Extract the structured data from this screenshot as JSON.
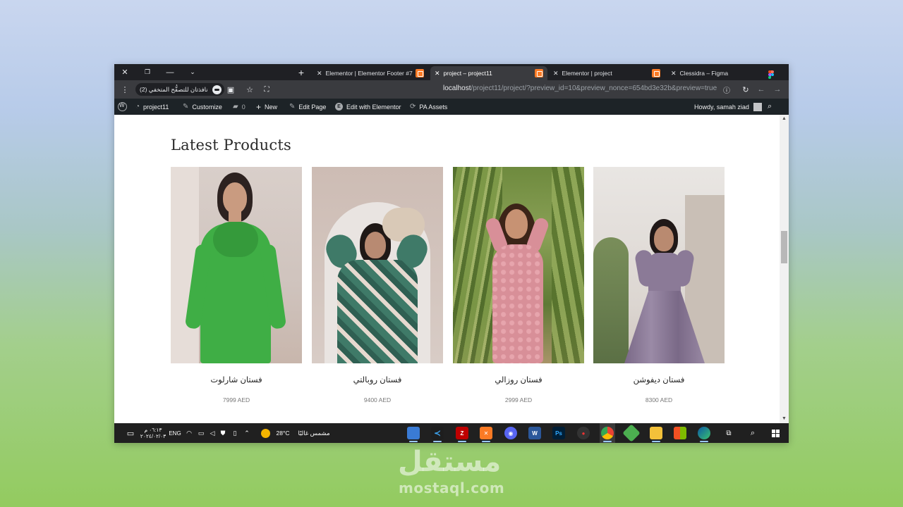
{
  "browser": {
    "tabs": [
      {
        "title": "Elementor | Elementor Footer #7",
        "active": false
      },
      {
        "title": "project – project11",
        "active": true
      },
      {
        "title": "Elementor | project",
        "active": false
      },
      {
        "title": "Clessidra – Figma",
        "active": false
      }
    ],
    "new_tab": "+",
    "incognito_label": "نافذتان للتصفُّح المتخفي (2)",
    "url_host": "localhost",
    "url_path": "/project11/project/?preview_id=10&preview_nonce=654bd3e32b&preview=true"
  },
  "wp_admin_bar": {
    "site_name": "project11",
    "customize": "Customize",
    "comments_count": "0",
    "new": "New",
    "edit_page": "Edit Page",
    "edit_with_elementor": "Edit with Elementor",
    "pa_assets": "PA Assets",
    "howdy": "Howdy, samah ziad"
  },
  "page": {
    "heading": "Latest Products",
    "products": [
      {
        "name": "فستان شارلوت",
        "price": "7999 AED",
        "dress_color": "#3fae45"
      },
      {
        "name": "فستان روبالتي",
        "price": "9400 AED",
        "dress_color": "#3f7a68"
      },
      {
        "name": "فستان روزالي",
        "price": "2999 AED",
        "dress_color": "#d88f98"
      },
      {
        "name": "فستان ديفوشن",
        "price": "8300 AED",
        "dress_color": "#8b7a97"
      }
    ]
  },
  "taskbar": {
    "time": "٠٦:١٣ م",
    "date": "٢٠٢٤/٠٢/٠٣",
    "lang": "ENG",
    "weather_temp": "28°C",
    "weather_text": "مشمس غالبًا"
  },
  "watermark": {
    "arabic": "مستقل",
    "latin": "mostaql.com"
  }
}
